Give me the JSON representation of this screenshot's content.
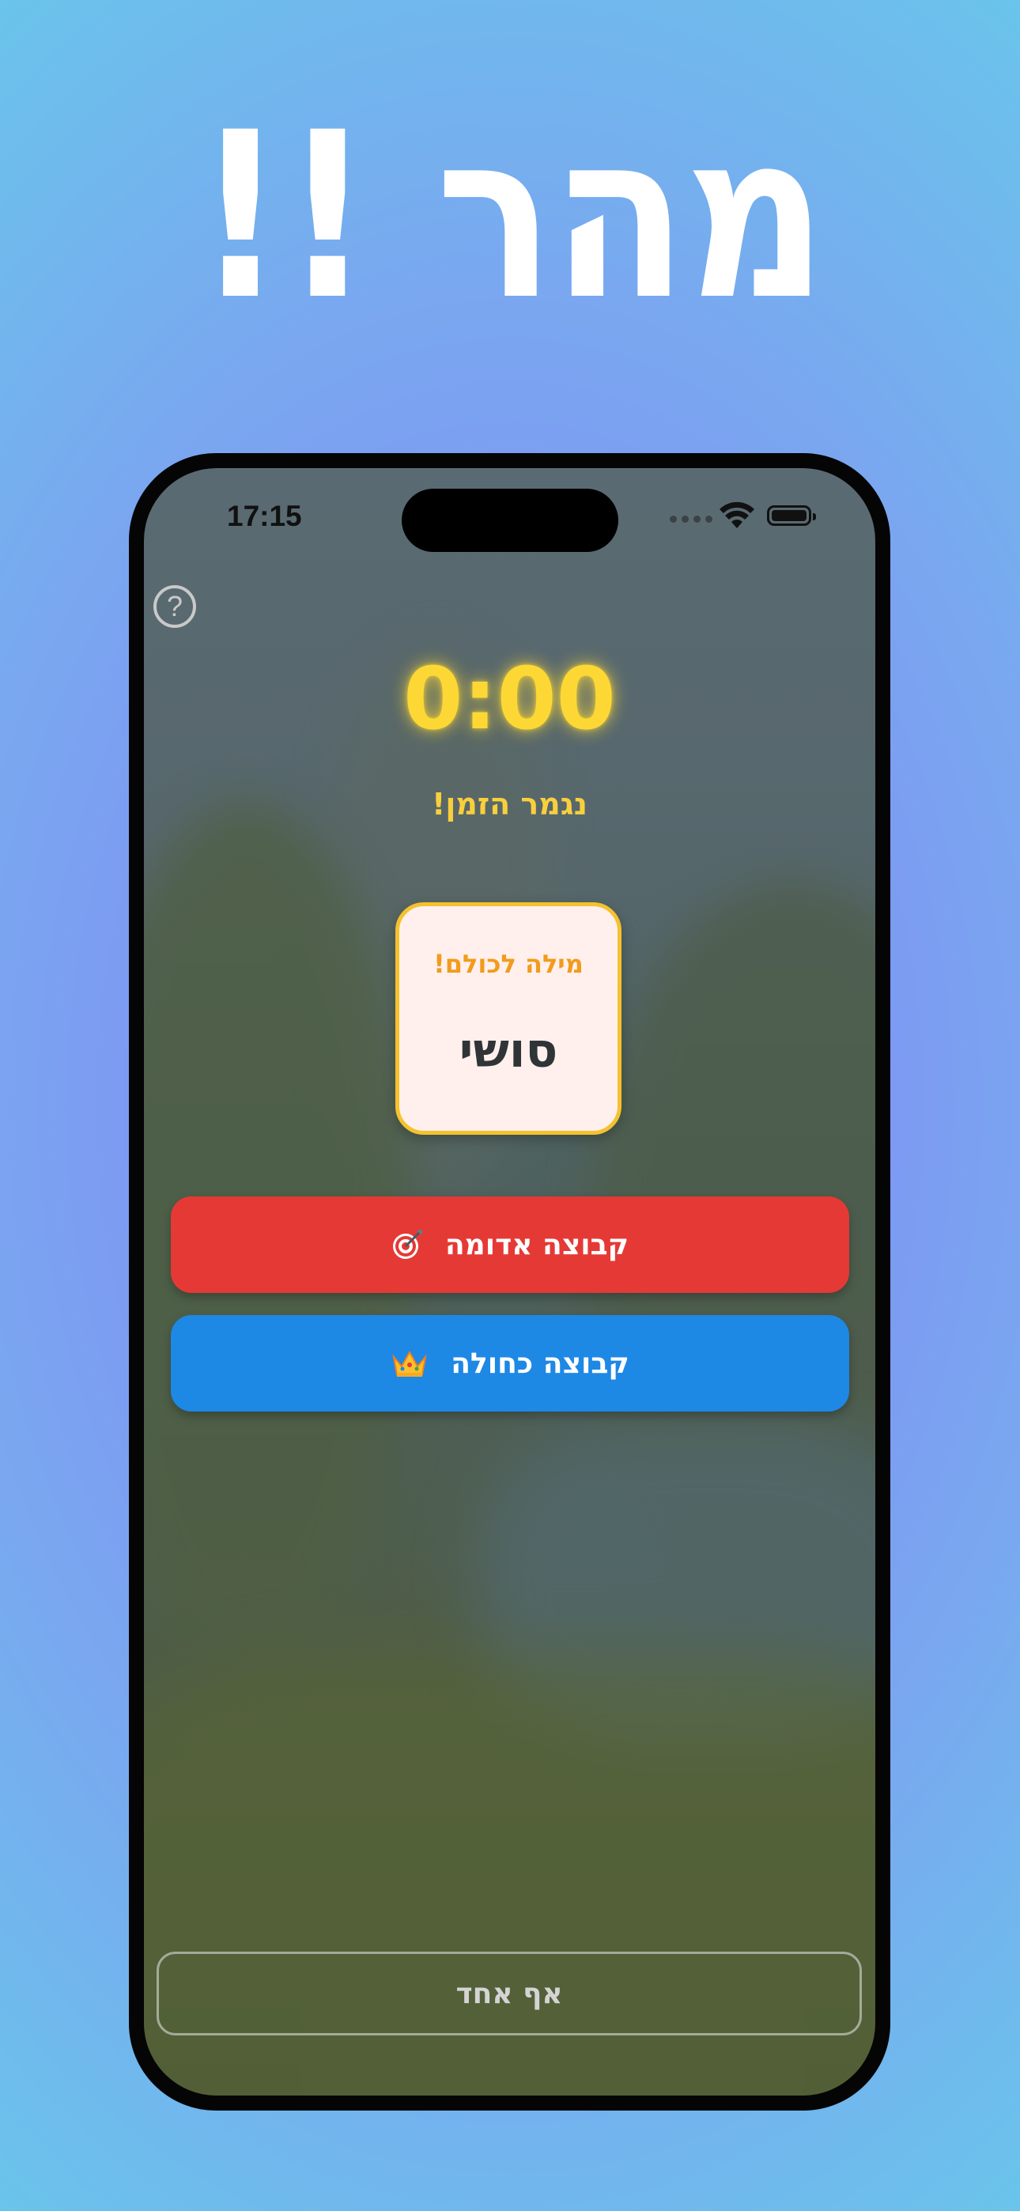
{
  "headline": "מהר !!",
  "status_bar": {
    "time": "17:15"
  },
  "game": {
    "timer": "0:00",
    "times_up_message": "נגמר הזמן!",
    "card": {
      "label": "מילה לכולם!",
      "word": "סושי"
    }
  },
  "teams": [
    {
      "label": "קבוצה אדומה",
      "icon": "dart-target-icon",
      "color": "#e53935"
    },
    {
      "label": "קבוצה כחולה",
      "icon": "crown-icon",
      "color": "#1e88e5"
    }
  ],
  "nobody_button": {
    "label": "אף אחד"
  },
  "colors": {
    "timer": "#fdd835",
    "card_border": "#f4c22e",
    "card_label": "#f29b1c"
  }
}
